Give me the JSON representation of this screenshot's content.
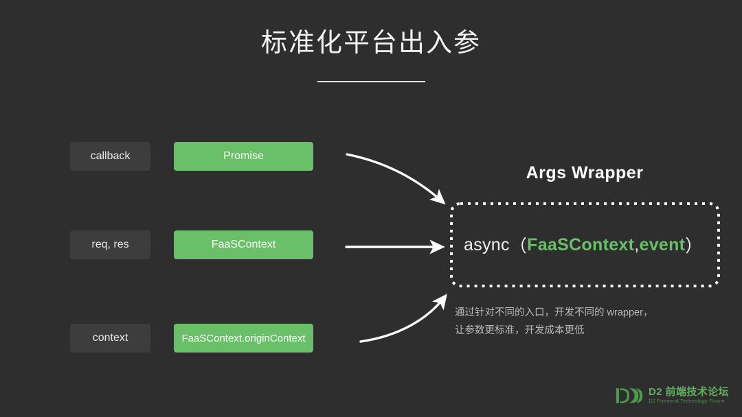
{
  "slide": {
    "background_color": "#2e2e2e",
    "title": "标准化平台出入参"
  },
  "colors": {
    "accent_green": "#6abf69",
    "chip_grey": "#3d3d3d",
    "text_primary": "#f2f2f2",
    "text_muted": "#b9b9b9",
    "logo_green": "#5fae5c"
  },
  "mappings": [
    {
      "source": "callback",
      "target": "Promise"
    },
    {
      "source": "req, res",
      "target": "FaaSContext"
    },
    {
      "source": "context",
      "target": "FaaSContext.originContext"
    }
  ],
  "wrapper": {
    "heading": "Args Wrapper",
    "signature": {
      "keyword": "async",
      "open_paren": "（",
      "arg1": "FaaSContext",
      "separator": ", ",
      "arg2": "event",
      "close_paren": "）"
    },
    "caption_line1": "通过针对不同的入口，开发不同的 wrapper，",
    "caption_line2": "让参数更标准，开发成本更低"
  },
  "arrows": [
    {
      "name": "arrow-promise-to-wrapper",
      "style": "curved-down"
    },
    {
      "name": "arrow-faascontext-to-wrapper",
      "style": "straight"
    },
    {
      "name": "arrow-origincontext-to-wrapper",
      "style": "curved-up"
    }
  ],
  "footer": {
    "logo_title": "D2 前端技术论坛",
    "logo_subtitle": "D2 Frontend Technology Forum"
  }
}
